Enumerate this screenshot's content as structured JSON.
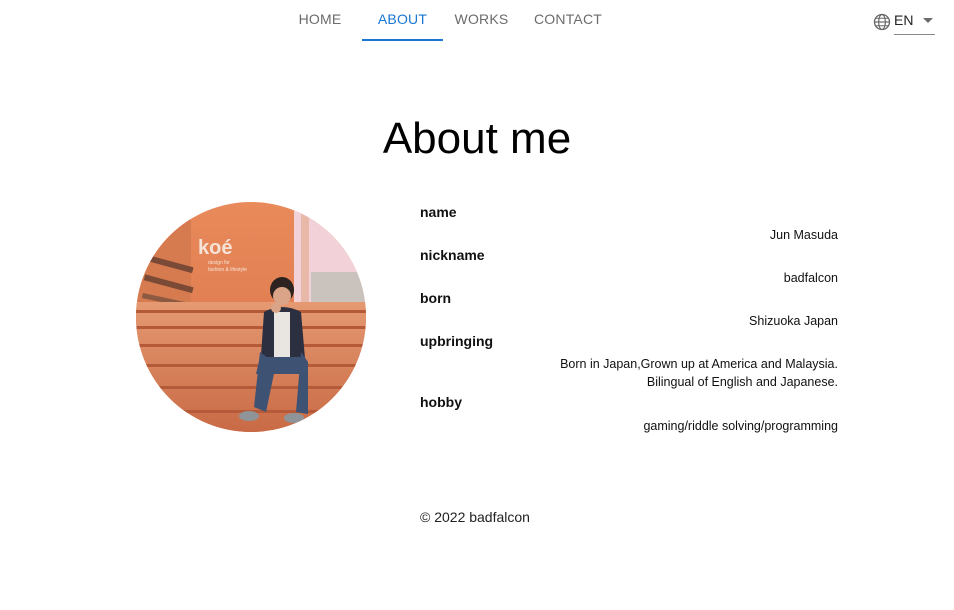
{
  "nav": {
    "tabs": [
      {
        "label": "HOME"
      },
      {
        "label": "ABOUT"
      },
      {
        "label": "WORKS"
      },
      {
        "label": "CONTACT"
      }
    ],
    "active_tab": "ABOUT",
    "accent_color": "#1976d2"
  },
  "language": {
    "icon": "globe-icon",
    "value": "EN"
  },
  "heading": "About me",
  "profile": {
    "name": {
      "label": "name",
      "value": "Jun Masuda"
    },
    "nickname": {
      "label": "nickname",
      "value": "badfalcon"
    },
    "born": {
      "label": "born",
      "value": "Shizuoka Japan"
    },
    "upbringing": {
      "label": "upbringing",
      "value_line1": "Born in Japan,Grown up at America and Malaysia.",
      "value_line2": "Bilingual of English and Japanese."
    },
    "hobby": {
      "label": "hobby",
      "value": "gaming/riddle solving/programming"
    }
  },
  "photo": {
    "sign_text": "koé",
    "sign_subtext_1": "design for",
    "sign_subtext_2": "fashion & lifestyle"
  },
  "footer": "© 2022 badfalcon"
}
